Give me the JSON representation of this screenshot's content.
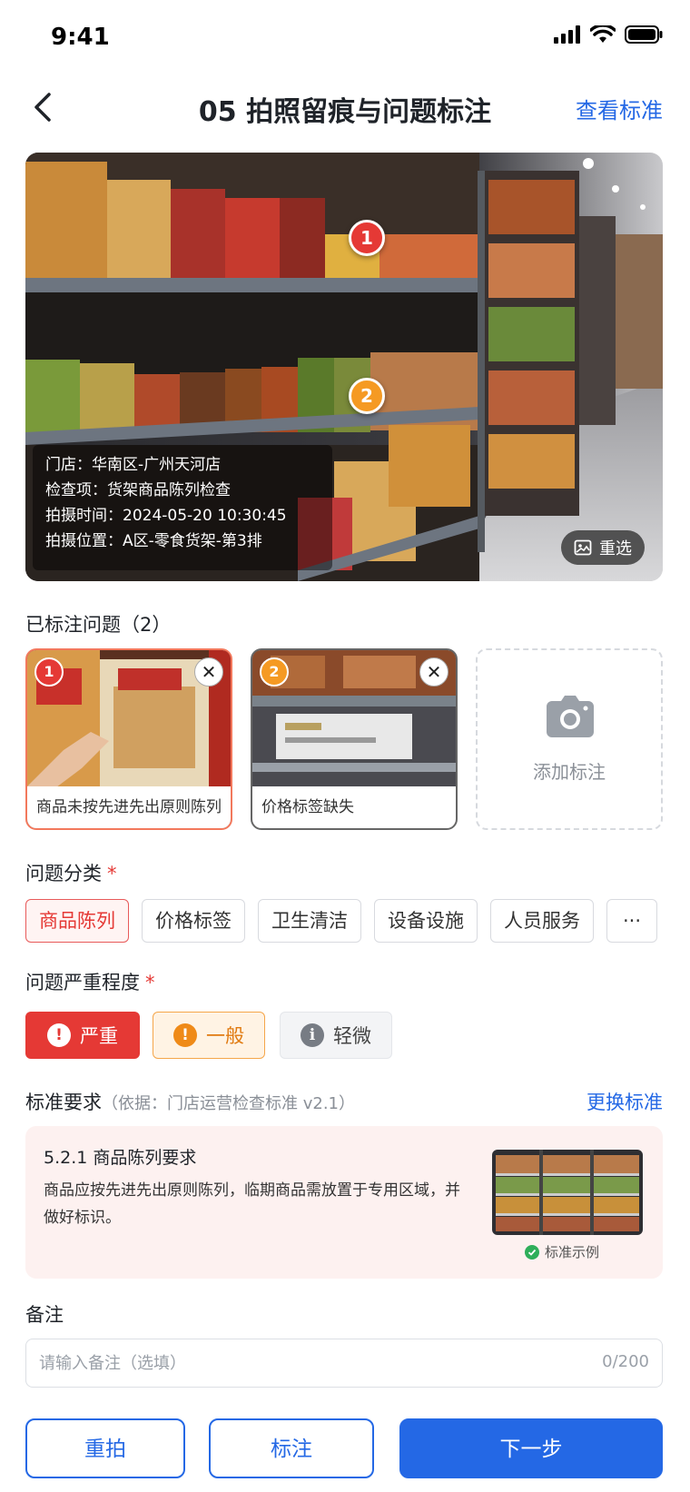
{
  "status": {
    "time": "9:41"
  },
  "nav": {
    "title": "05 拍照留痕与问题标注",
    "link": "查看标准"
  },
  "photo": {
    "markers": [
      "1",
      "2"
    ],
    "info": {
      "store": "门店：华南区-广州天河店",
      "item": "检查项：货架商品陈列检查",
      "time": "拍摄时间：2024-05-20 10:30:45",
      "location": "拍摄位置：A区-零食货架-第3排"
    },
    "reselect_label": "重选"
  },
  "tagged": {
    "title": "已标注问题（2）",
    "items": [
      {
        "num": "1",
        "caption": "商品未按先进先出原则陈列",
        "color": "#e53935"
      },
      {
        "num": "2",
        "caption": "价格标签缺失",
        "color": "#f59a23"
      }
    ],
    "add_label": "添加标注"
  },
  "category": {
    "title": "问题分类",
    "required": "*",
    "options": [
      "商品陈列",
      "价格标签",
      "卫生清洁",
      "设备设施",
      "人员服务",
      "···"
    ],
    "selected": "商品陈列"
  },
  "severity": {
    "title": "问题严重程度",
    "required": "*",
    "options": [
      {
        "label": "严重",
        "icon": "!"
      },
      {
        "label": "一般",
        "icon": "!"
      },
      {
        "label": "轻微",
        "icon": "i"
      }
    ],
    "selected": "严重"
  },
  "standard": {
    "title": "标准要求",
    "basis": "（依据：门店运营检查标准 v2.1）",
    "change_label": "更换标准",
    "clause_title": "5.2.1 商品陈列要求",
    "clause_desc": "商品应按先进先出原则陈列，临期商品需放置于专用区域，并做好标识。",
    "example_label": "标准示例"
  },
  "note": {
    "label": "备注",
    "placeholder": "请输入备注（选填）",
    "value": "",
    "counter": "0/200"
  },
  "actions": {
    "retake": "重拍",
    "annotate": "标注",
    "next": "下一步"
  },
  "colors": {
    "accent": "#2468e5",
    "danger": "#e53935",
    "warning": "#f59a23"
  }
}
